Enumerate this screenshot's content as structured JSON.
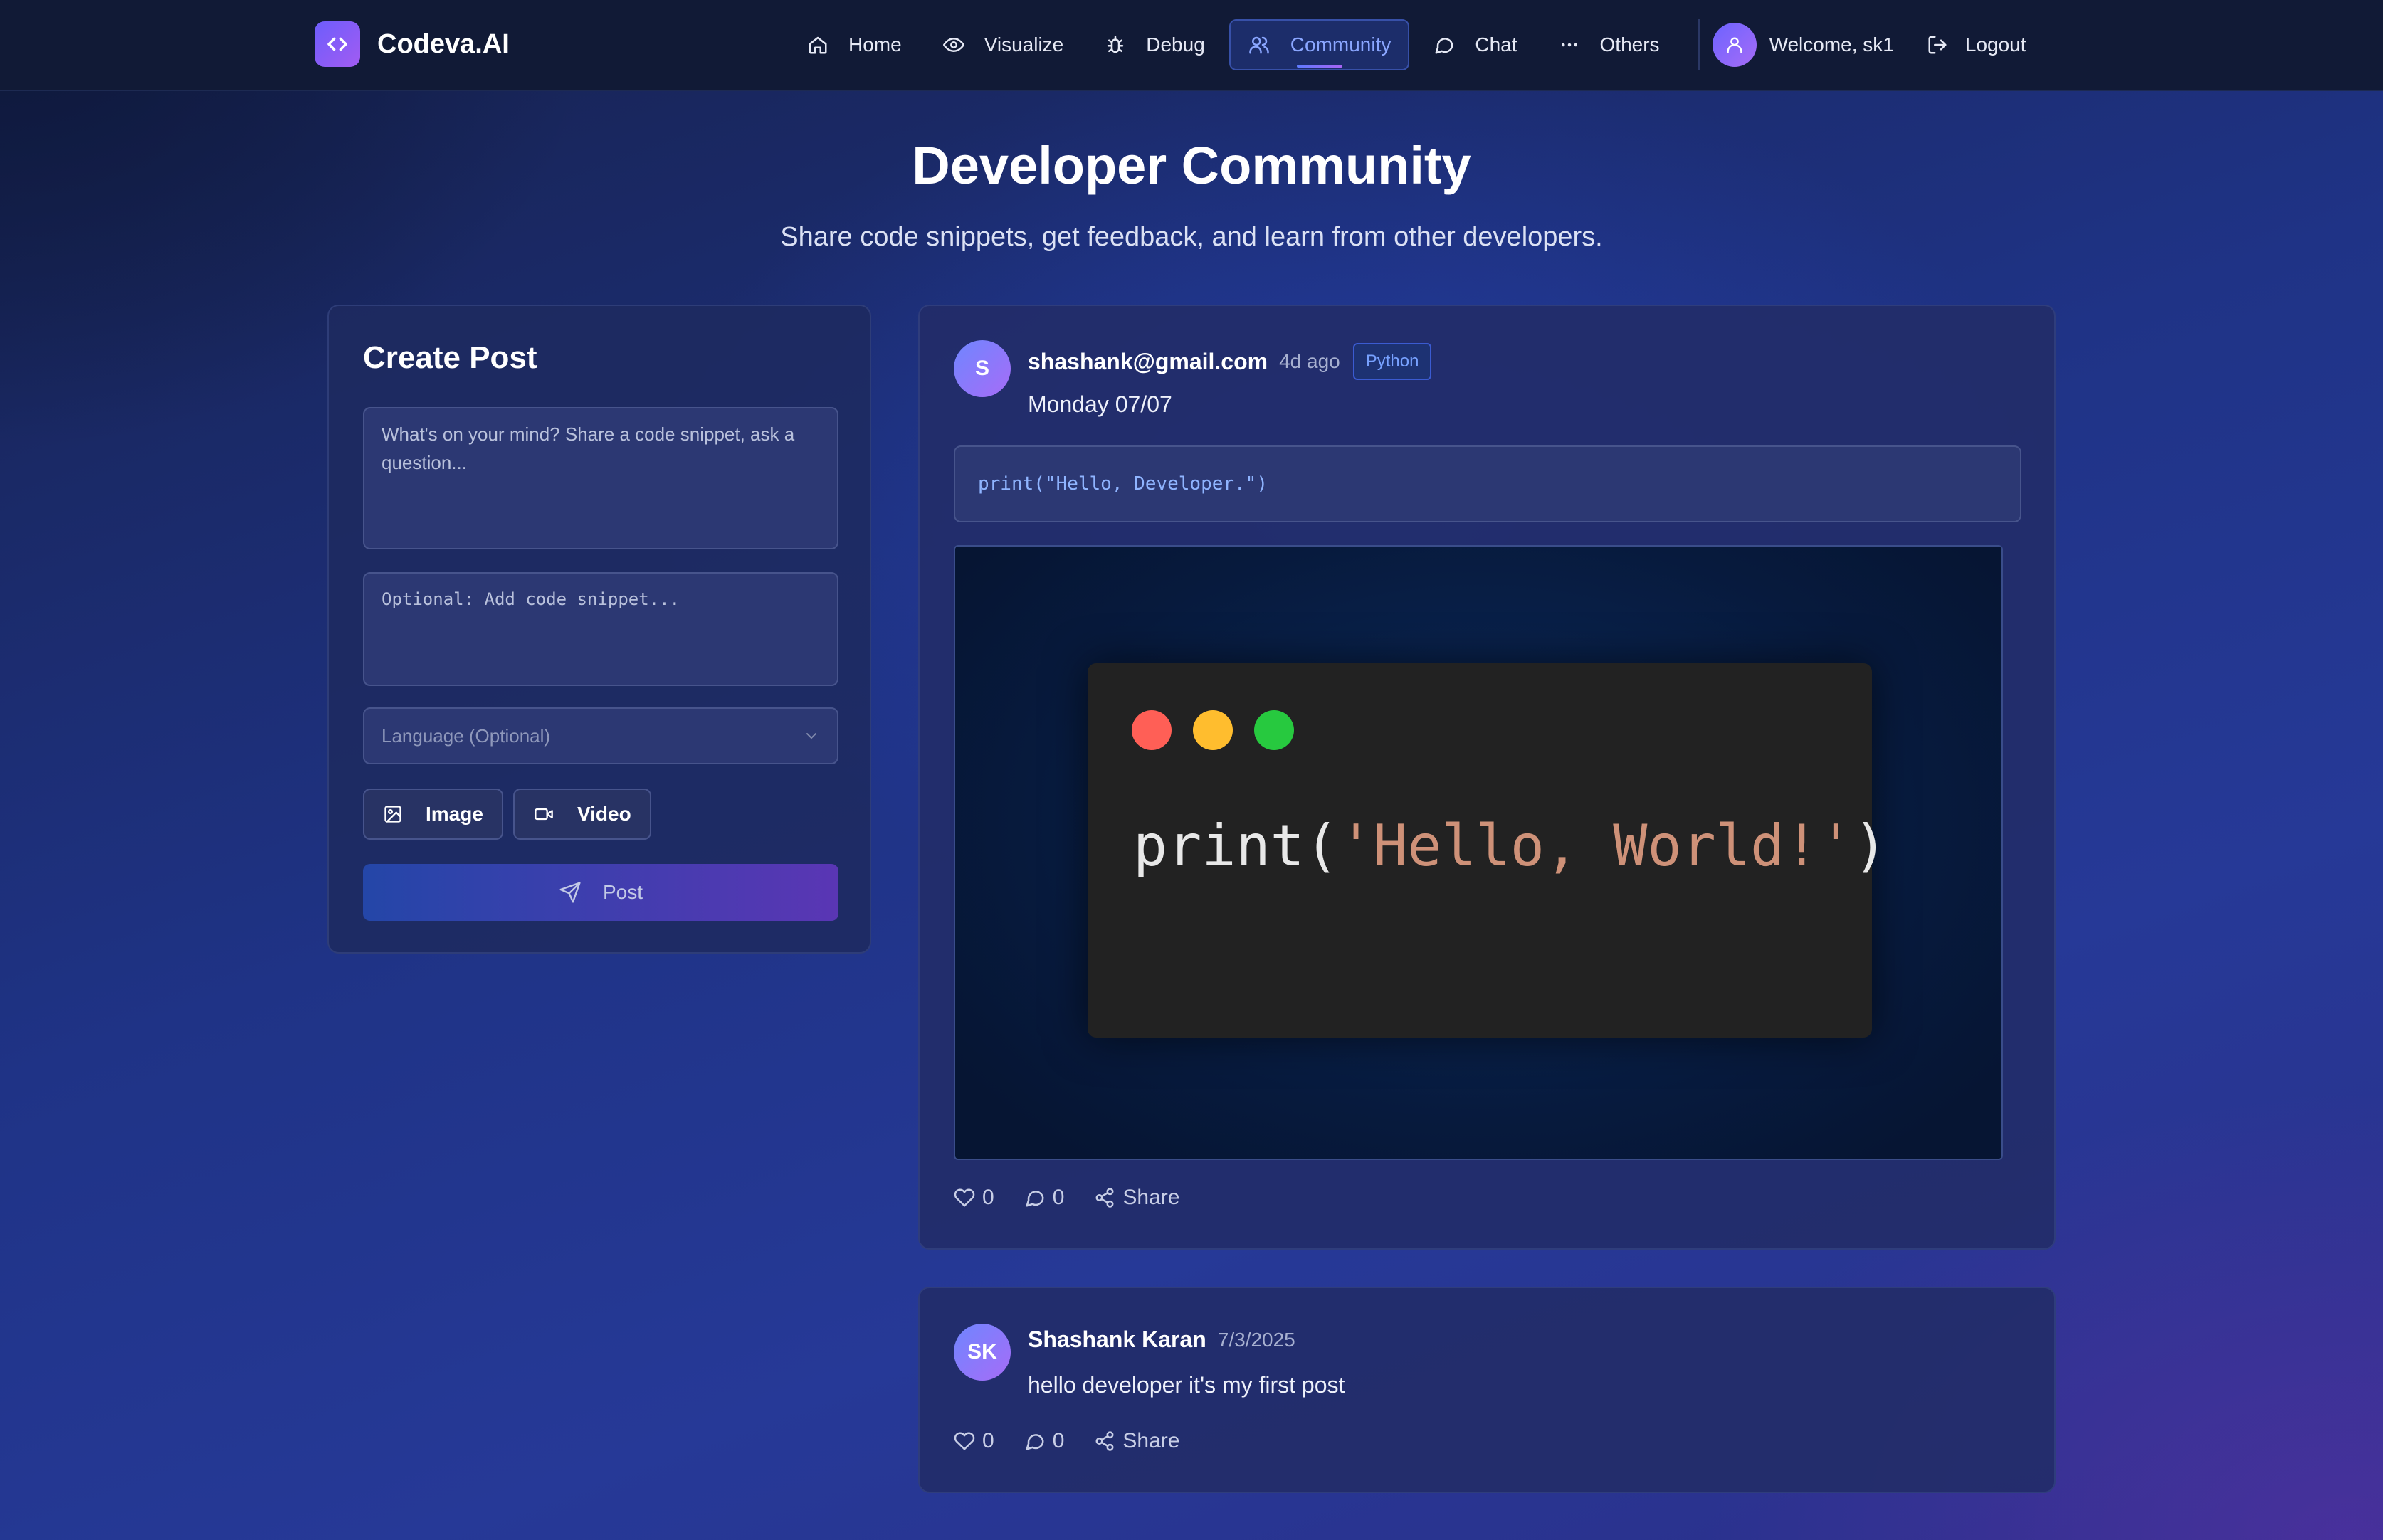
{
  "nav": {
    "brand": "Codeva.AI",
    "items": [
      {
        "label": "Home",
        "icon": "home-icon"
      },
      {
        "label": "Visualize",
        "icon": "eye-icon"
      },
      {
        "label": "Debug",
        "icon": "bug-icon"
      },
      {
        "label": "Community",
        "icon": "users-icon",
        "active": true
      },
      {
        "label": "Chat",
        "icon": "chat-icon"
      },
      {
        "label": "Others",
        "icon": "more-icon"
      }
    ],
    "welcome": "Welcome, sk1",
    "logout": "Logout"
  },
  "header": {
    "title": "Developer Community",
    "subtitle": "Share code snippets, get feedback, and learn from other developers."
  },
  "create_post": {
    "title": "Create Post",
    "text_placeholder": "What's on your mind? Share a code snippet, ask a question...",
    "code_placeholder": "Optional: Add code snippet...",
    "language_placeholder": "Language (Optional)",
    "image_label": "Image",
    "video_label": "Video",
    "post_label": "Post"
  },
  "posts": [
    {
      "avatar": "S",
      "author": "shashank@gmail.com",
      "time": "4d ago",
      "language": "Python",
      "text": "Monday 07/07",
      "code": "print(\"Hello, Developer.\")",
      "media_code_fn": "print(",
      "media_code_str": "'Hello, World!'",
      "media_code_end": ")",
      "likes": "0",
      "comments": "0",
      "share_label": "Share"
    },
    {
      "avatar": "SK",
      "author": "Shashank Karan",
      "time": "7/3/2025",
      "text": "hello developer it's my first post",
      "likes": "0",
      "comments": "0",
      "share_label": "Share"
    }
  ],
  "colors": {
    "accent": "#8aa6ff",
    "brand_gradient_start": "#6d5dfc",
    "brand_gradient_end": "#a25cf2",
    "language_badge": "#77a1ff"
  }
}
